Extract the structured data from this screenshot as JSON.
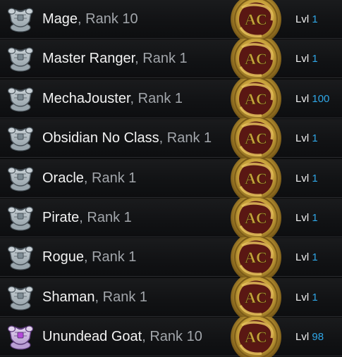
{
  "class_list": {
    "items": [
      {
        "class_name": "Mage",
        "rank": "Rank 10",
        "level_label": "Lvl",
        "level": "1",
        "icon": "armor-chest-icon",
        "icon_variant": "steel"
      },
      {
        "class_name": "Master Ranger",
        "rank": "Rank 1",
        "level_label": "Lvl",
        "level": "1",
        "icon": "armor-chest-icon",
        "icon_variant": "steel"
      },
      {
        "class_name": "MechaJouster",
        "rank": "Rank 1",
        "level_label": "Lvl",
        "level": "100",
        "icon": "armor-chest-icon",
        "icon_variant": "steel"
      },
      {
        "class_name": "Obsidian No Class",
        "rank": "Rank 1",
        "level_label": "Lvl",
        "level": "1",
        "icon": "armor-chest-icon",
        "icon_variant": "steel"
      },
      {
        "class_name": "Oracle",
        "rank": "Rank 1",
        "level_label": "Lvl",
        "level": "1",
        "icon": "armor-chest-icon",
        "icon_variant": "steel"
      },
      {
        "class_name": "Pirate",
        "rank": "Rank 1",
        "level_label": "Lvl",
        "level": "1",
        "icon": "armor-chest-icon",
        "icon_variant": "steel"
      },
      {
        "class_name": "Rogue",
        "rank": "Rank 1",
        "level_label": "Lvl",
        "level": "1",
        "icon": "armor-chest-icon",
        "icon_variant": "steel"
      },
      {
        "class_name": "Shaman",
        "rank": "Rank 1",
        "level_label": "Lvl",
        "level": "1",
        "icon": "armor-chest-icon",
        "icon_variant": "steel"
      },
      {
        "class_name": "Unundead Goat",
        "rank": "Rank 10",
        "level_label": "Lvl",
        "level": "98",
        "icon": "armor-chest-icon",
        "icon_variant": "purple"
      }
    ],
    "badge_text": "AC",
    "badge_icon": "ac-coin-icon",
    "colors": {
      "class_name": "#f2f2f2",
      "rank": "#a2a6ab",
      "level_value": "#2fa6e6",
      "badge_gold": "#c8a13a",
      "badge_red": "#5a1713"
    }
  }
}
